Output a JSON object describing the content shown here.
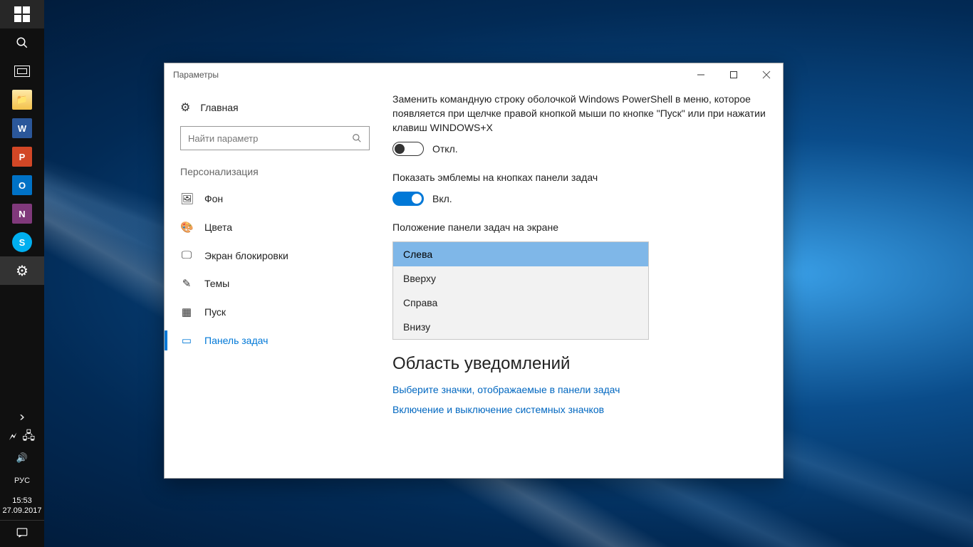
{
  "taskbar": {
    "start": "start",
    "search": "search",
    "taskview": "task-view",
    "apps": {
      "explorer": "📁",
      "word": "W",
      "ppt": "P",
      "outlook": "O",
      "onenote": "N",
      "skype": "S"
    },
    "settings": "⚙",
    "tray": {
      "chevron": "›",
      "battery": "🔋",
      "network": "🖧",
      "sound": "🔊",
      "lang": "РУС",
      "time": "15:53",
      "date": "27.09.2017",
      "action_center": "💬"
    }
  },
  "window": {
    "title": "Параметры",
    "home_label": "Главная",
    "search_placeholder": "Найти параметр",
    "section": "Персонализация",
    "nav": {
      "background": "Фон",
      "colors": "Цвета",
      "lockscreen": "Экран блокировки",
      "themes": "Темы",
      "start": "Пуск",
      "taskbar": "Панель задач"
    }
  },
  "settings": {
    "powershell": {
      "title": "Заменить командную строку оболочкой Windows PowerShell в меню, которое появляется при щелчке правой кнопкой мыши по кнопке \"Пуск\" или при нажатии клавиш WINDOWS+X",
      "state_label": "Откл."
    },
    "badges": {
      "title": "Показать эмблемы на кнопках панели задач",
      "state_label": "Вкл."
    },
    "position": {
      "title": "Положение панели задач на экране",
      "options": {
        "left": "Слева",
        "top": "Вверху",
        "right": "Справа",
        "bottom": "Внизу"
      }
    },
    "notif": {
      "heading": "Область уведомлений",
      "link_icons": "Выберите значки, отображаемые в панели задач",
      "link_system": "Включение и выключение системных значков"
    }
  }
}
